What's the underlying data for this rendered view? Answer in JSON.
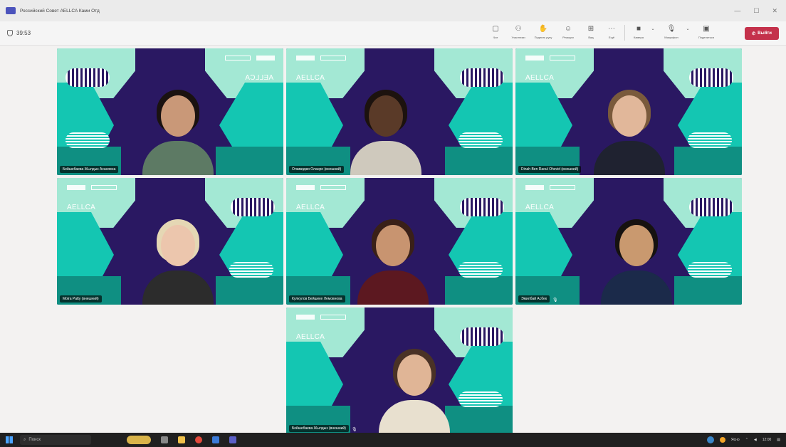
{
  "window": {
    "title": "Российский Совет AELLCA Ками Отд"
  },
  "toolbar": {
    "timer": "39:53",
    "tools": [
      {
        "label": "Чат",
        "icon": "chat-icon"
      },
      {
        "label": "Участники",
        "icon": "people-icon"
      },
      {
        "label": "Поднять руку",
        "icon": "raise-hand-icon"
      },
      {
        "label": "Реакции",
        "icon": "reactions-icon"
      },
      {
        "label": "Вид",
        "icon": "view-icon"
      },
      {
        "label": "Ещё",
        "icon": "more-icon"
      }
    ],
    "devices": [
      {
        "label": "Камера",
        "icon": "camera-icon"
      },
      {
        "label": "Микрофон",
        "icon": "mic-icon"
      },
      {
        "label": "Поделиться",
        "icon": "share-icon"
      }
    ],
    "leave_label": "Выйти",
    "leave_color": "#c4314b"
  },
  "tiles": [
    {
      "name": "Бейшебаева Жылдыз Асановна",
      "mirrored": true,
      "muted": false
    },
    {
      "name": "Оламиджи Оланре (внешний)",
      "mirrored": false,
      "muted": false
    },
    {
      "name": "Dinah Ben Raoul Ohevid (внешний)",
      "mirrored": false,
      "muted": false
    },
    {
      "name": "Moira Patty (внешний)",
      "mirrored": false,
      "muted": false
    },
    {
      "name": "Кулкулов Бейшеке Лемовнова",
      "mirrored": false,
      "muted": false
    },
    {
      "name": "Эмилбай Асбек",
      "mirrored": false,
      "muted": true
    },
    {
      "name": "Бейшебаева Жылдыз (внешний)",
      "mirrored": false,
      "muted": true
    }
  ],
  "brand": {
    "event_logo": "AELLCA",
    "colors": {
      "purple": "#2a1862",
      "teal": "#14c6b2",
      "mint": "#a3e8d4",
      "dark_teal": "#0f8f82"
    }
  },
  "taskbar": {
    "search_placeholder": "Поиск",
    "weather": "Ясно",
    "clock": "12:00"
  }
}
